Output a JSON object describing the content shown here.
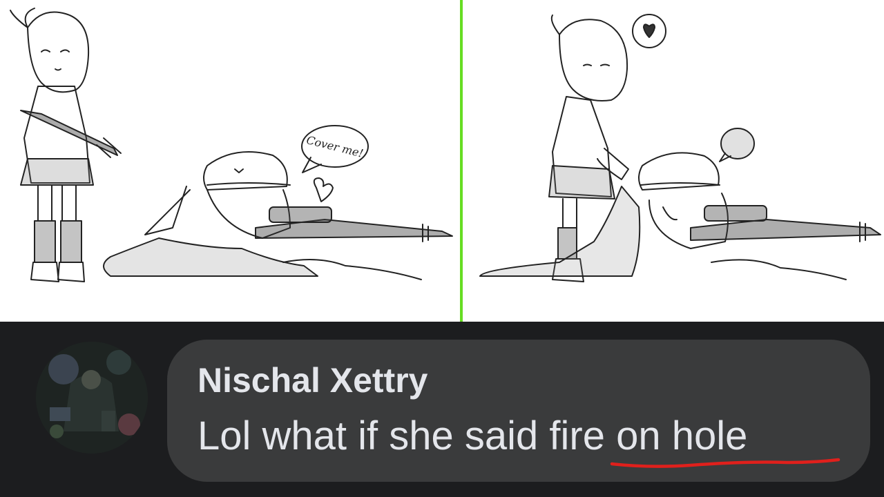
{
  "colors": {
    "comic_background": "#ffffff",
    "panel_divider": "#66dd22",
    "page_background": "#1c1d1f",
    "comment_bubble": "#3a3b3c",
    "comment_text": "#e4e6eb",
    "underline": "#e0201c"
  },
  "comic": {
    "left_panel": {
      "speech_bubble_text": "Cover me!"
    },
    "right_panel": {
      "thought_bubble_icon": "heart-icon"
    }
  },
  "comment": {
    "author": "Nischal Xettry",
    "text_prefix": "Lol what if she said ",
    "text_highlight": "fire on hole",
    "avatar_icon": "profile-photo"
  }
}
